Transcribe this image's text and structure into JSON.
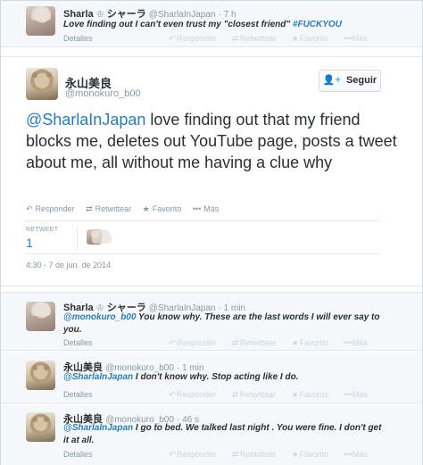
{
  "tweets": {
    "t1": {
      "name": "Sharla",
      "name_suffix": "シャーラ",
      "handle": "@SharlaInJapan",
      "time": "· 7 h",
      "text_plain": "Love finding out I can't even trust my \"closest friend\"",
      "hashtag": "#FUCKYOU",
      "detalles": "Detalles",
      "actions": [
        "Responder",
        "Retwittear",
        "Favorito",
        "Más"
      ]
    },
    "main": {
      "name": "永山美良",
      "handle": "@monokuro_b00",
      "follow_label": "Seguir",
      "mention": "@SharlaInJapan",
      "text_rest": " love finding out that my friend blocks me, deletes out YouTube page, posts a tweet about me, all without me having a clue why",
      "actions": [
        "Responder",
        "Retwittear",
        "Favorito",
        "Más"
      ],
      "retweet_label": "RETWEET",
      "retweet_count": "1",
      "timestamp": "4:30 - 7 de jun. de 2014"
    },
    "r1": {
      "name": "Sharla",
      "name_suffix": "シャーラ",
      "handle": "@SharlaInJapan",
      "time": "· 1 min",
      "mention": "@monokuro_b00",
      "text_rest": " You know why. These are the last words I will ever say to you.",
      "detalles": "Detalles",
      "actions": [
        "Responder",
        "Retwittear",
        "Favorito",
        "Más"
      ]
    },
    "r2": {
      "name": "永山美良",
      "handle": "@monokuro_b00",
      "time": "· 1 min",
      "mention": "@SharlaInJapan",
      "text_rest": " I don't know why. Stop acting like I do.",
      "detalles": "Detalles",
      "actions": [
        "Responder",
        "Retwittear",
        "Favorito",
        "Más"
      ]
    },
    "r3": {
      "name": "永山美良",
      "handle": "@monokuro_b00",
      "time": "· 46 s",
      "mention": "@SharlaInJapan",
      "text_rest": " I go to bed. We talked last night . You were fine. I don't get it at all.",
      "detalles": "Detalles",
      "actions": [
        "Responder",
        "Retwittear",
        "Favorito",
        "Más"
      ]
    }
  },
  "colors": {
    "link": "#2b7bb9",
    "muted": "#8899a6",
    "border": "#e1e8ed",
    "gray_bg": "#f5f8fa"
  },
  "icons": {
    "crown": "crown-icon",
    "follow": "add-user-icon",
    "reply": "reply-icon",
    "retweet": "retweet-icon",
    "favorite": "star-icon",
    "more": "more-icon"
  }
}
